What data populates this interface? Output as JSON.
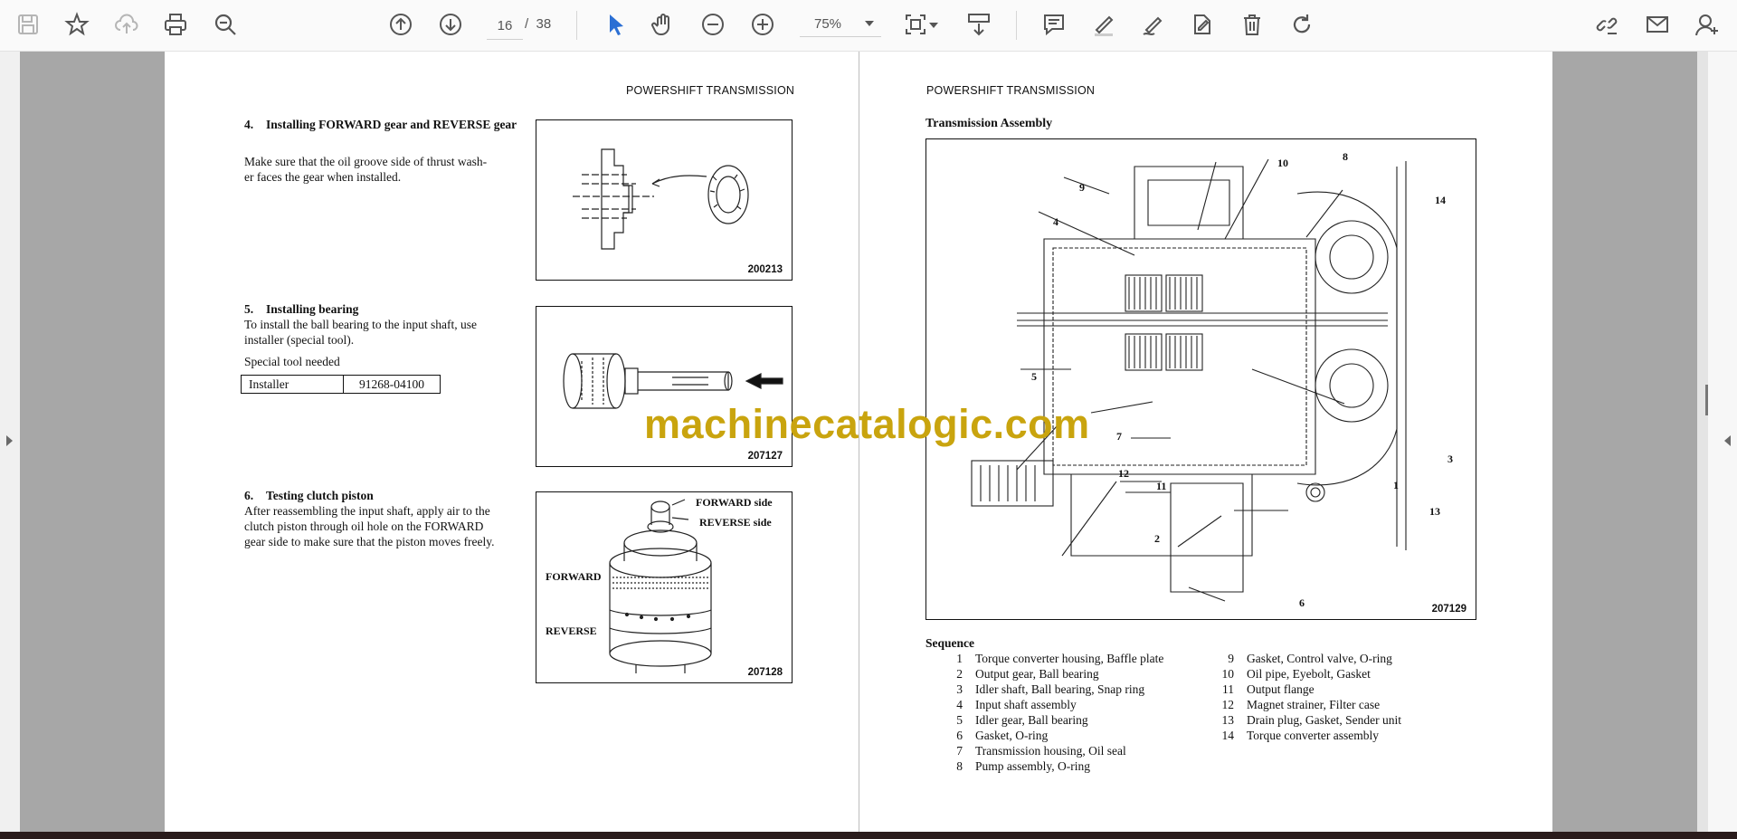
{
  "toolbar": {
    "page_current": "16",
    "page_separator": "/",
    "page_total": "38",
    "zoom": "75%",
    "icons": [
      "save-icon",
      "bookmark-star-icon",
      "upload-cloud-icon",
      "print-icon",
      "zoom-search-icon",
      "previous-page-icon",
      "next-page-icon",
      "select-arrow-icon",
      "hand-pan-icon",
      "zoom-out-icon",
      "zoom-in-icon",
      "fit-page-icon",
      "scroll-mode-icon",
      "comment-icon",
      "highlight-pen-icon",
      "draw-icon",
      "sign-icon",
      "delete-icon",
      "rotate-icon",
      "share-link-icon",
      "email-icon",
      "account-icon"
    ]
  },
  "left_page": {
    "header": "POWERSHIFT TRANSMISSION",
    "sections": [
      {
        "title_num": "4.",
        "title": "Installing FORWARD gear and REVERSE gear",
        "body_lines": [
          "Make sure that the oil groove side of thrust wash-",
          "er faces the gear when installed."
        ],
        "figure": "200213"
      },
      {
        "title_num": "5.",
        "title": "Installing bearing",
        "body_lines": [
          "To install the ball bearing to the input shaft, use",
          "installer (special tool)."
        ],
        "note": "Special tool needed",
        "tool_table": {
          "name": "Installer",
          "part": "91268-04100"
        },
        "figure": "207127"
      },
      {
        "title_num": "6.",
        "title": "Testing clutch piston",
        "body_lines": [
          "After reassembling the input shaft, apply air to the",
          "clutch piston through oil hole on the FORWARD",
          "gear side to make sure that the piston moves freely."
        ],
        "figure": "207128",
        "figure_labels": {
          "forward_side": "FORWARD side",
          "reverse_side": "REVERSE side",
          "forward": "FORWARD",
          "reverse": "REVERSE"
        }
      }
    ]
  },
  "right_page": {
    "header": "POWERSHIFT TRANSMISSION",
    "title": "Transmission Assembly",
    "figure": "207129",
    "callouts": [
      "1",
      "2",
      "3",
      "4",
      "5",
      "6",
      "7",
      "8",
      "9",
      "10",
      "11",
      "12",
      "13",
      "14"
    ],
    "sequence_title": "Sequence",
    "sequence": [
      {
        "n": "1",
        "text": "Torque converter housing, Baffle plate"
      },
      {
        "n": "2",
        "text": "Output gear, Ball bearing"
      },
      {
        "n": "3",
        "text": "Idler shaft, Ball bearing, Snap ring"
      },
      {
        "n": "4",
        "text": "Input shaft assembly"
      },
      {
        "n": "5",
        "text": "Idler gear, Ball bearing"
      },
      {
        "n": "6",
        "text": "Gasket, O-ring"
      },
      {
        "n": "7",
        "text": "Transmission housing, Oil seal"
      },
      {
        "n": "8",
        "text": "Pump assembly, O-ring"
      },
      {
        "n": "9",
        "text": "Gasket, Control valve, O-ring"
      },
      {
        "n": "10",
        "text": "Oil pipe, Eyebolt, Gasket"
      },
      {
        "n": "11",
        "text": "Output flange"
      },
      {
        "n": "12",
        "text": "Magnet strainer, Filter case"
      },
      {
        "n": "13",
        "text": "Drain plug, Gasket, Sender unit"
      },
      {
        "n": "14",
        "text": "Torque converter assembly"
      }
    ]
  },
  "watermark": "machinecatalogic.com"
}
